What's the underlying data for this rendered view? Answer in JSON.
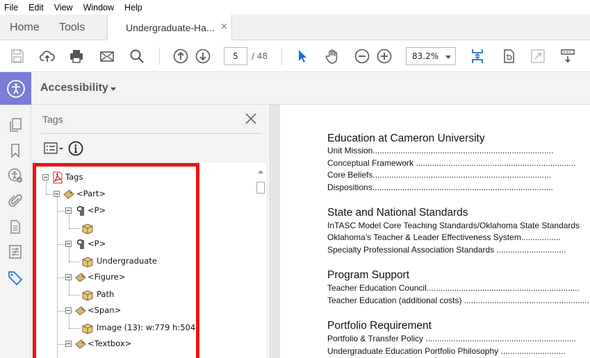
{
  "menu": [
    "File",
    "Edit",
    "View",
    "Window",
    "Help"
  ],
  "tabs": {
    "home": "Home",
    "tools": "Tools",
    "document": "Undergraduate-Ha...",
    "close": "×"
  },
  "toolbar": {
    "page_current": "5",
    "page_total": "/ 48",
    "zoom": "83.2%"
  },
  "accessibility": {
    "label": "Accessibility"
  },
  "panel": {
    "title": "Tags",
    "tree": [
      {
        "label": "Tags"
      },
      {
        "label": "<Part>"
      },
      {
        "label": "<P>"
      },
      {
        "label": ""
      },
      {
        "label": "<P>"
      },
      {
        "label": "Undergraduate"
      },
      {
        "label": "<Figure>"
      },
      {
        "label": "Path"
      },
      {
        "label": "<Span>"
      },
      {
        "label": "Image (13): w:779 h:504"
      },
      {
        "label": "<Textbox>"
      }
    ]
  },
  "document": {
    "sections": [
      {
        "heading": "Education at Cameron University",
        "items": [
          "Unit Mission..............................................................................",
          "Conceptual Framework .....................................................................",
          "Core Beliefs.............................................................................",
          "Dispositions.............................................................................."
        ]
      },
      {
        "heading": "State and National Standards",
        "items": [
          "InTASC Model Core Teaching Standards/Oklahoma State Standards",
          "Oklahoma’s Teacher & Leader Effectiveness System.................",
          "Specialty Professional Association Standards .............................."
        ]
      },
      {
        "heading": "Program Support",
        "items": [
          "Teacher Education Council..................................................................",
          "Teacher Education (additional costs) ......................................................"
        ]
      },
      {
        "heading": "Portfolio Requirement",
        "items": [
          "Portfolio & Transfer Policy .................................................................",
          "Undergraduate Education Portfolio Philosophy ............................"
        ]
      }
    ]
  },
  "colors": {
    "accent": "#7b7dd6",
    "highlight_frame": "#ee1111",
    "tool_blue": "#1f6fd1"
  }
}
